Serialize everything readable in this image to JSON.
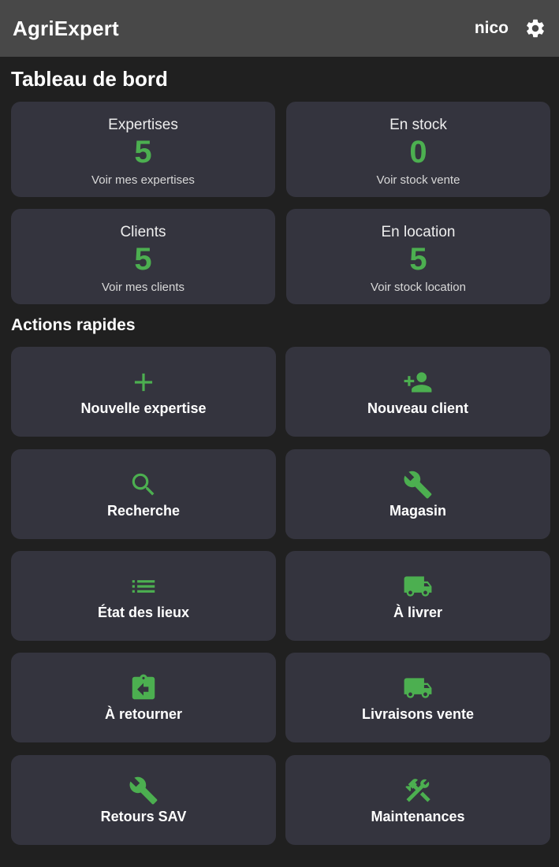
{
  "appbar": {
    "title": "AgriExpert",
    "user": "nico",
    "settings_icon": "gear-icon"
  },
  "dashboard": {
    "title": "Tableau de bord",
    "stats": [
      {
        "label": "Expertises",
        "value": "5",
        "link": "Voir mes expertises"
      },
      {
        "label": "En stock",
        "value": "0",
        "link": "Voir stock vente"
      },
      {
        "label": "Clients",
        "value": "5",
        "link": "Voir mes clients"
      },
      {
        "label": "En location",
        "value": "5",
        "link": "Voir stock location"
      }
    ]
  },
  "actions": {
    "title": "Actions rapides",
    "items": [
      {
        "label": "Nouvelle expertise",
        "icon": "add-icon"
      },
      {
        "label": "Nouveau client",
        "icon": "person-add-icon"
      },
      {
        "label": "Recherche",
        "icon": "search-icon"
      },
      {
        "label": "Magasin",
        "icon": "wrench-icon"
      },
      {
        "label": "État des lieux",
        "icon": "list-icon"
      },
      {
        "label": "À livrer",
        "icon": "truck-icon"
      },
      {
        "label": "À retourner",
        "icon": "clipboard-return-icon"
      },
      {
        "label": "Livraisons vente",
        "icon": "truck-icon"
      },
      {
        "label": "Retours SAV",
        "icon": "wrench-icon"
      },
      {
        "label": "Maintenances",
        "icon": "tools-icon"
      }
    ]
  },
  "colors": {
    "accent": "#4caf50",
    "appbar": "#484848",
    "background": "#202020",
    "card": "#34343e"
  }
}
